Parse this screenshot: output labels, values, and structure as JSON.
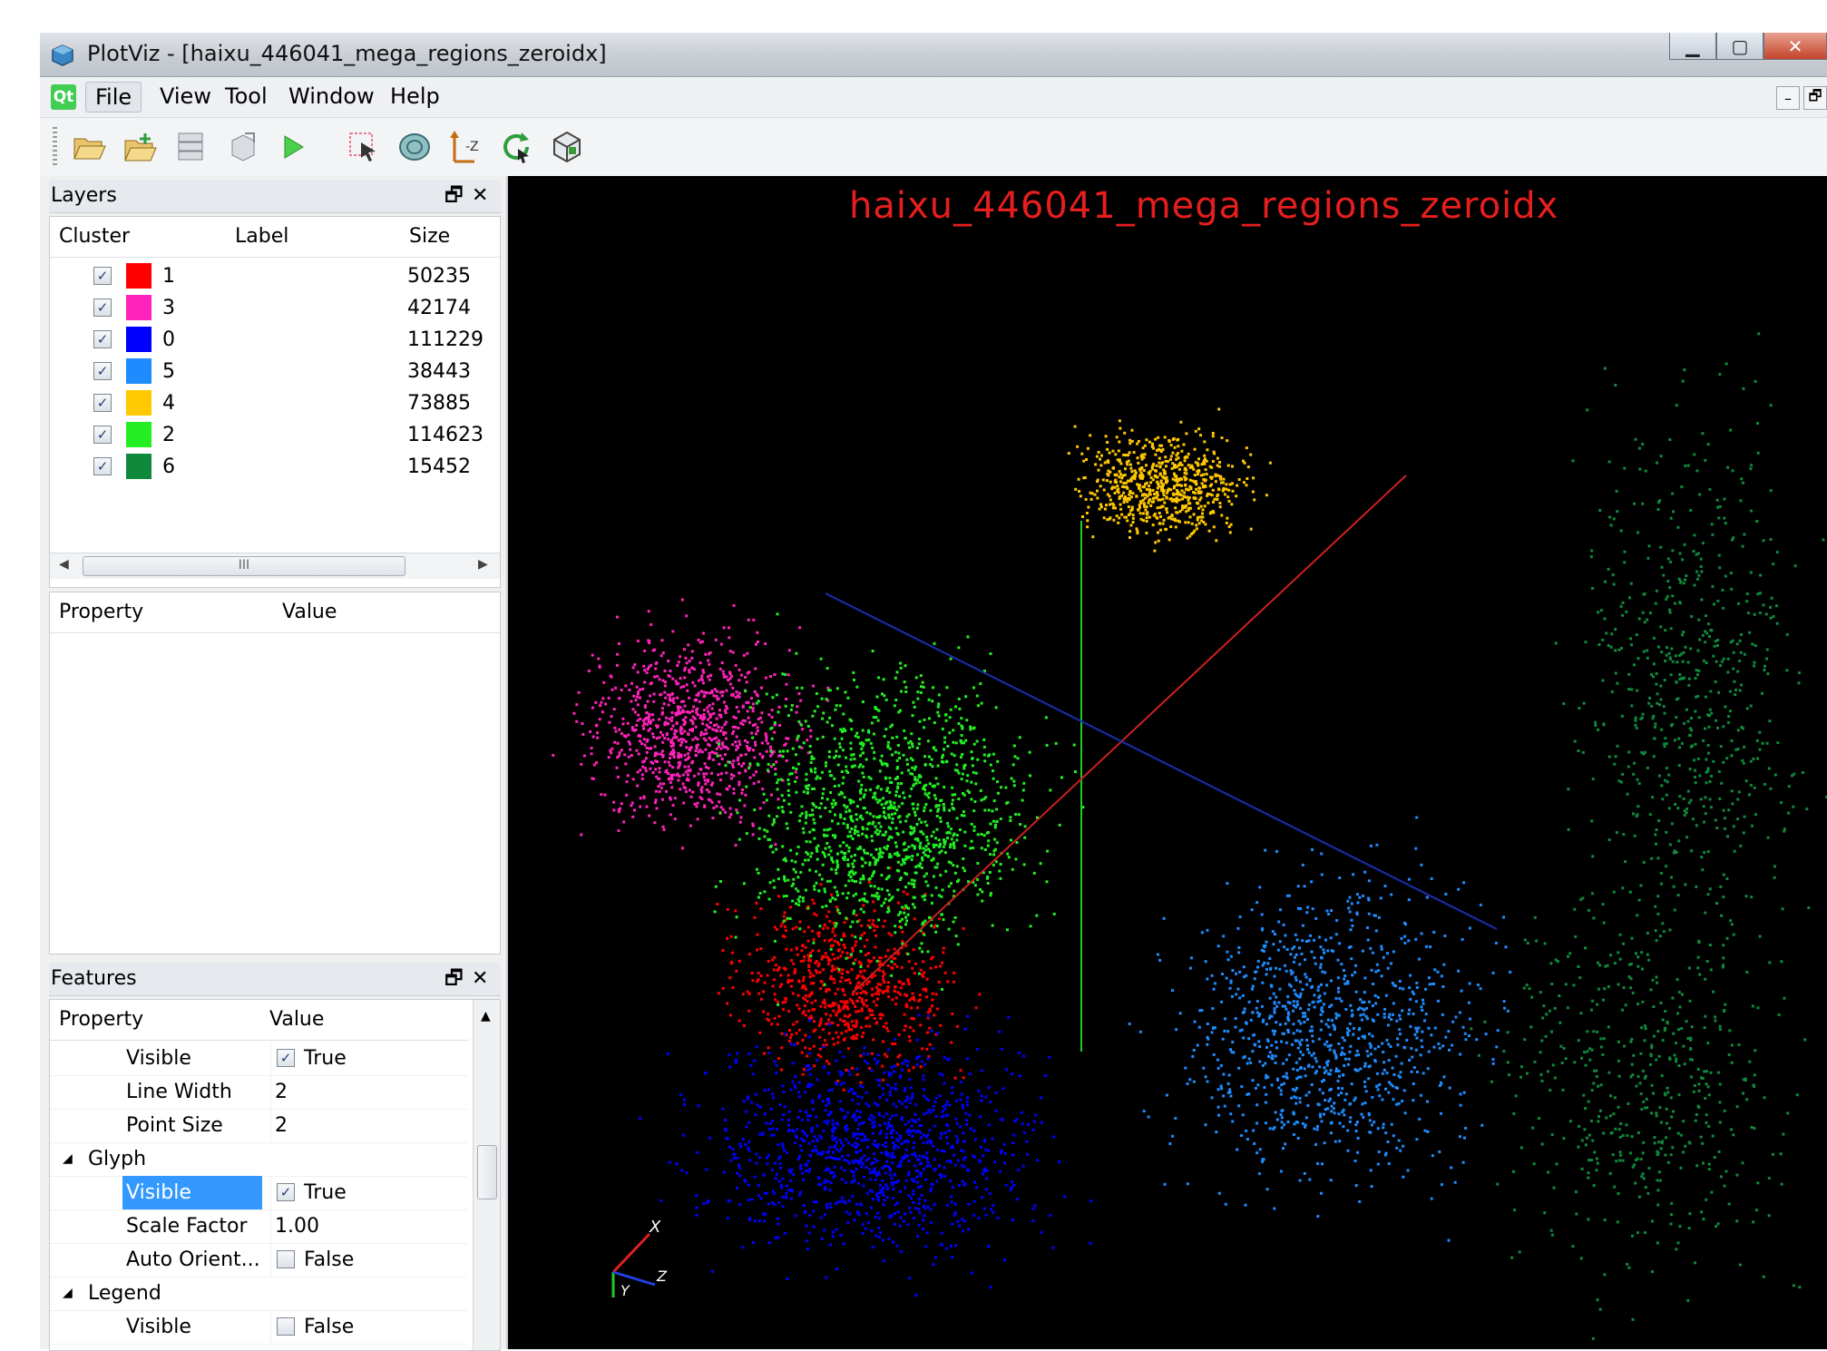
{
  "window": {
    "title": "PlotViz - [haixu_446041_mega_regions_zeroidx]",
    "controls": [
      "minimize",
      "maximize",
      "close"
    ]
  },
  "menubar": {
    "logo": "Qt",
    "items": [
      "File",
      "View",
      "Tool",
      "Window",
      "Help"
    ],
    "active": "File"
  },
  "toolbar": {
    "tools": [
      "open-folder-icon",
      "open-add-icon",
      "cube-stack-icon",
      "cube-export-icon",
      "play-icon",
      "select-region-icon",
      "rotate-icon",
      "axis-z-icon",
      "refresh-icon",
      "cube-view-icon"
    ]
  },
  "layers": {
    "title": "Layers",
    "columns": [
      "Cluster",
      "Label",
      "Size"
    ],
    "rows": [
      {
        "cluster": "1",
        "label": "",
        "size": "50235",
        "color": "#ff0000",
        "checked": true
      },
      {
        "cluster": "3",
        "label": "",
        "size": "42174",
        "color": "#ff22bb",
        "checked": true
      },
      {
        "cluster": "0",
        "label": "",
        "size": "111229",
        "color": "#0000ff",
        "checked": true
      },
      {
        "cluster": "5",
        "label": "",
        "size": "38443",
        "color": "#1e8cff",
        "checked": true
      },
      {
        "cluster": "4",
        "label": "",
        "size": "73885",
        "color": "#ffc800",
        "checked": true
      },
      {
        "cluster": "2",
        "label": "",
        "size": "114623",
        "color": "#22ee22",
        "checked": true
      },
      {
        "cluster": "6",
        "label": "",
        "size": "15452",
        "color": "#0f8a3c",
        "checked": true
      }
    ],
    "scroll_thumb": "III"
  },
  "properties": {
    "columns": [
      "Property",
      "Value"
    ]
  },
  "features": {
    "title": "Features",
    "columns": [
      "Property",
      "Value"
    ],
    "rows": [
      {
        "name": "Visible",
        "value": "True",
        "checkbox": true,
        "checked": true,
        "indent": 2
      },
      {
        "name": "Line Width",
        "value": "2",
        "indent": 2
      },
      {
        "name": "Point Size",
        "value": "2",
        "indent": 2
      },
      {
        "name": "Glyph",
        "section": true,
        "indent": 1
      },
      {
        "name": "Visible",
        "value": "True",
        "checkbox": true,
        "checked": true,
        "indent": 2,
        "selected": true
      },
      {
        "name": "Scale Factor",
        "value": "1.00",
        "indent": 2
      },
      {
        "name": "Auto Orient...",
        "value": "False",
        "checkbox": true,
        "checked": false,
        "indent": 2
      },
      {
        "name": "Legend",
        "section": true,
        "indent": 1
      },
      {
        "name": "Visible",
        "value": "False",
        "checkbox": true,
        "checked": false,
        "indent": 2
      }
    ]
  },
  "plot": {
    "title": "haixu_446041_mega_regions_zeroidx",
    "title_color": "#e61e1e",
    "axis_labels": [
      "X",
      "Y",
      "Z"
    ]
  }
}
